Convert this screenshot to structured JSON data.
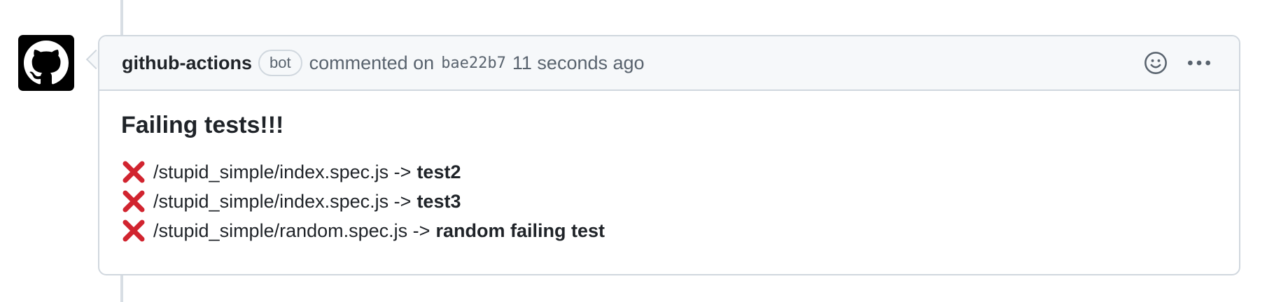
{
  "comment": {
    "author": "github-actions",
    "badge": "bot",
    "action_text": "commented on",
    "commit_sha": "bae22b7",
    "timestamp": "11 seconds ago",
    "avatar_icon": "github-octocat-icon",
    "actions": [
      {
        "icon": "smiley-icon",
        "label": "Add reaction"
      },
      {
        "icon": "kebab-horizontal-icon",
        "label": "More options"
      }
    ],
    "body": {
      "title": "Failing tests!!!",
      "tests": [
        {
          "status_icon": "red-x-icon",
          "path": "/stupid_simple/index.spec.js ->",
          "name": "test2"
        },
        {
          "status_icon": "red-x-icon",
          "path": "/stupid_simple/index.spec.js ->",
          "name": "test3"
        },
        {
          "status_icon": "red-x-icon",
          "path": "/stupid_simple/random.spec.js ->",
          "name": "random failing test"
        }
      ]
    }
  },
  "colors": {
    "border": "#d0d7de",
    "header_bg": "#f6f8fa",
    "muted_text": "#59636e",
    "fail_red": "#d1242f"
  }
}
